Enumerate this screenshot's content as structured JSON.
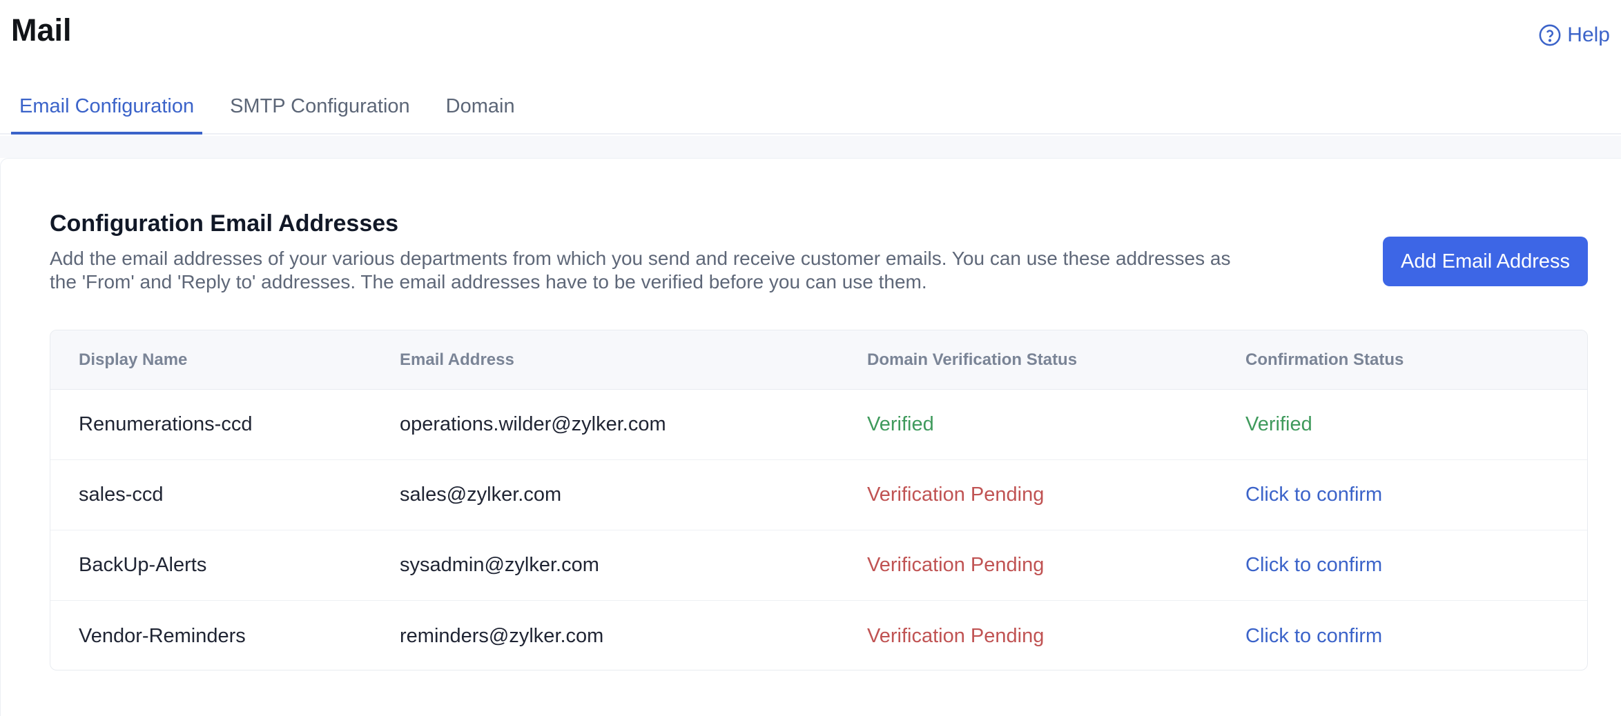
{
  "app": {
    "title": "Mail",
    "help_label": "Help"
  },
  "tabs": [
    {
      "label": "Email Configuration",
      "active": true
    },
    {
      "label": "SMTP Configuration",
      "active": false
    },
    {
      "label": "Domain",
      "active": false
    }
  ],
  "section": {
    "title": "Configuration Email Addresses",
    "description": "Add the email addresses of your various departments from which you send and receive customer emails. You can use these addresses as the 'From' and 'Reply to' addresses. The email addresses have to be verified before you can use them.",
    "add_button_label": "Add Email Address"
  },
  "table": {
    "headers": [
      "Display Name",
      "Email Address",
      "Domain Verification Status",
      "Confirmation Status"
    ],
    "rows": [
      {
        "display_name": "Renumerations-ccd",
        "email": "operations.wilder@zylker.com",
        "domain_status": "Verified",
        "confirmation": "Verified"
      },
      {
        "display_name": "sales-ccd",
        "email": "sales@zylker.com",
        "domain_status": "Verification Pending",
        "confirmation": "Click to confirm"
      },
      {
        "display_name": "BackUp-Alerts",
        "email": "sysadmin@zylker.com",
        "domain_status": "Verification Pending",
        "confirmation": "Click to confirm"
      },
      {
        "display_name": "Vendor-Reminders",
        "email": "reminders@zylker.com",
        "domain_status": "Verification Pending",
        "confirmation": "Click to confirm"
      }
    ]
  },
  "colors": {
    "accent": "#3b63c9",
    "button": "#3d66e6",
    "verified": "#3f9a5c",
    "pending": "#c05353"
  },
  "icons": {
    "help": "help-circle-icon"
  }
}
